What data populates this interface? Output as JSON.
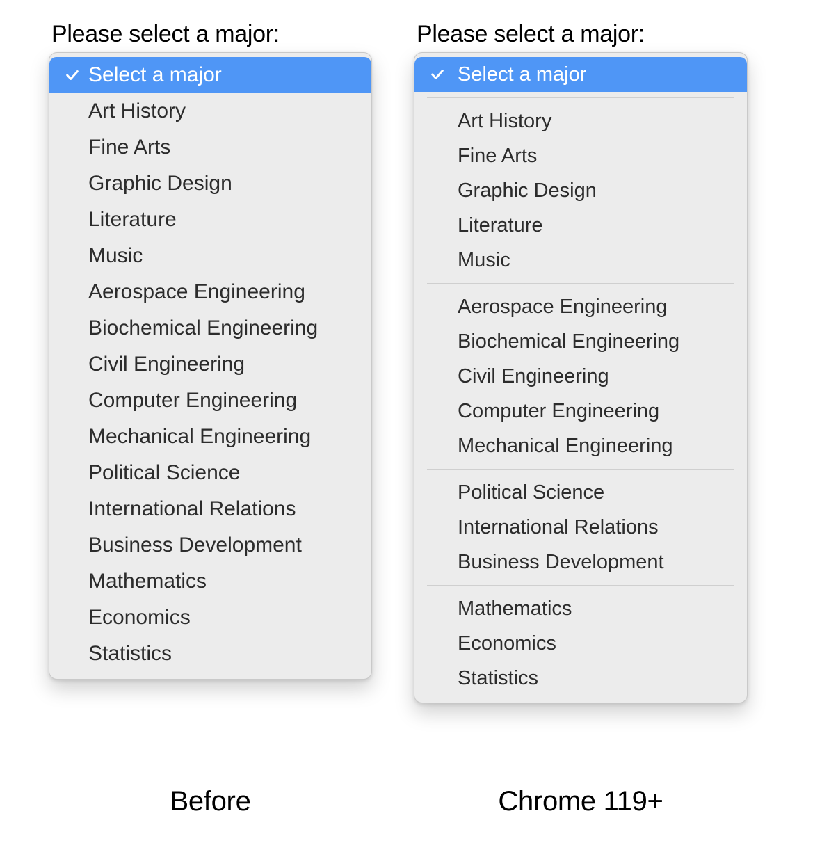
{
  "before": {
    "prompt": "Please select a major:",
    "caption": "Before",
    "selected_label": "Select a major",
    "options": [
      "Art History",
      "Fine Arts",
      "Graphic Design",
      "Literature",
      "Music",
      "Aerospace Engineering",
      "Biochemical Engineering",
      "Civil Engineering",
      "Computer Engineering",
      "Mechanical Engineering",
      "Political Science",
      "International Relations",
      "Business Development",
      "Mathematics",
      "Economics",
      "Statistics"
    ]
  },
  "after": {
    "prompt": "Please select a major:",
    "caption": "Chrome 119+",
    "selected_label": "Select a major",
    "groups": [
      [
        "Art History",
        "Fine Arts",
        "Graphic Design",
        "Literature",
        "Music"
      ],
      [
        "Aerospace Engineering",
        "Biochemical Engineering",
        "Civil Engineering",
        "Computer Engineering",
        "Mechanical Engineering"
      ],
      [
        "Political Science",
        "International Relations",
        "Business Development"
      ],
      [
        "Mathematics",
        "Economics",
        "Statistics"
      ]
    ]
  }
}
